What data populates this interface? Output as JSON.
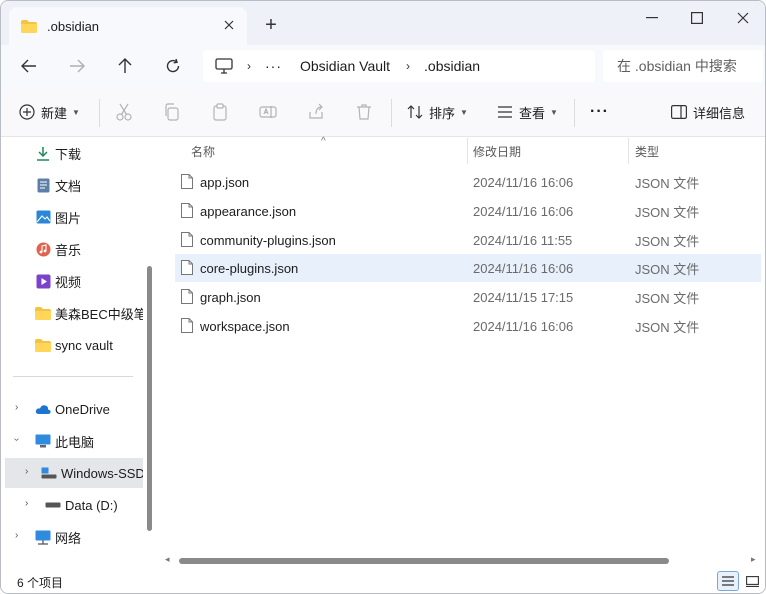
{
  "tab": {
    "title": ".obsidian",
    "new_tab": "+"
  },
  "address": {
    "ellipsis": "···",
    "crumbs": [
      "Obsidian Vault",
      ".obsidian"
    ],
    "separator": "›"
  },
  "search": {
    "placeholder": "在 .obsidian 中搜索"
  },
  "toolbar": {
    "new_label": "新建",
    "sort_label": "排序",
    "view_label": "查看",
    "more": "···",
    "details_label": "详细信息"
  },
  "sidebar": {
    "quick": [
      {
        "label": "下载",
        "icon": "download-icon"
      },
      {
        "label": "文档",
        "icon": "document-icon"
      },
      {
        "label": "图片",
        "icon": "pictures-icon"
      },
      {
        "label": "音乐",
        "icon": "music-icon"
      },
      {
        "label": "视频",
        "icon": "video-icon"
      },
      {
        "label": "美森BEC中级笔记",
        "icon": "folder-icon"
      },
      {
        "label": "sync vault",
        "icon": "folder-icon"
      }
    ],
    "onedrive": "OneDrive",
    "this_pc": "此电脑",
    "drive_c": "Windows-SSD",
    "drive_d": "Data (D:)",
    "network": "网络"
  },
  "columns": {
    "name": "名称",
    "modified": "修改日期",
    "type": "类型"
  },
  "files": [
    {
      "name": "app.json",
      "modified": "2024/11/16 16:06",
      "type": "JSON 文件"
    },
    {
      "name": "appearance.json",
      "modified": "2024/11/16 16:06",
      "type": "JSON 文件"
    },
    {
      "name": "community-plugins.json",
      "modified": "2024/11/16 11:55",
      "type": "JSON 文件"
    },
    {
      "name": "core-plugins.json",
      "modified": "2024/11/16 16:06",
      "type": "JSON 文件"
    },
    {
      "name": "graph.json",
      "modified": "2024/11/15 17:15",
      "type": "JSON 文件"
    },
    {
      "name": "workspace.json",
      "modified": "2024/11/16 16:06",
      "type": "JSON 文件"
    }
  ],
  "status": {
    "count": "6 个项目"
  },
  "colors": {
    "accent": "#0067c0",
    "folder": "#f5c342",
    "selected_row": "#e8f1fb"
  }
}
